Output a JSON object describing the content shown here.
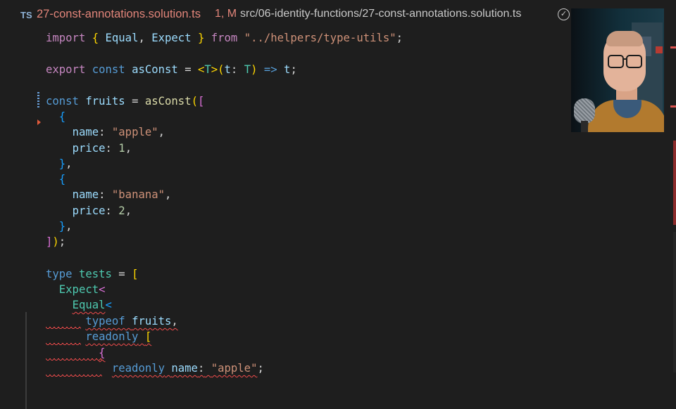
{
  "titlebar": {
    "lang_badge": "TS",
    "file_name": "27-const-annotations.solution.ts",
    "status": "1, M",
    "path": "src/06-identity-functions/27-const-annotations.solution.ts",
    "icons": [
      "check-circle-icon",
      "git-compare-icon",
      "more-icon"
    ]
  },
  "code": {
    "l1": [
      "import",
      "{",
      "Equal",
      ",",
      "Expect",
      "}",
      "from",
      "\"../helpers/type-utils\"",
      ";"
    ],
    "l2": [
      "export",
      "const",
      "asConst",
      "=",
      "<",
      "T",
      ">",
      "(",
      "t",
      ":",
      "T",
      ")",
      "=>",
      "t",
      ";"
    ],
    "l3": [
      "const",
      "fruits",
      "=",
      "asConst",
      "(",
      "["
    ],
    "l4": [
      "{"
    ],
    "l5": [
      "name",
      ":",
      "\"apple\"",
      ","
    ],
    "l6": [
      "price",
      ":",
      "1",
      ","
    ],
    "l7": [
      "}",
      ","
    ],
    "l8": [
      "{"
    ],
    "l9": [
      "name",
      ":",
      "\"banana\"",
      ","
    ],
    "l10": [
      "price",
      ":",
      "2",
      ","
    ],
    "l11": [
      "}",
      ","
    ],
    "l12": [
      "]",
      ")",
      ";"
    ],
    "l13": [
      "type",
      "tests",
      "=",
      "["
    ],
    "l14": [
      "Expect",
      "<"
    ],
    "l15": [
      "Equal",
      "<"
    ],
    "l16": [
      "typeof",
      "fruits",
      ","
    ],
    "l17": [
      "readonly",
      "["
    ],
    "l18": [
      "{"
    ],
    "l19": [
      "readonly",
      "name",
      ":",
      "\"apple\"",
      ";"
    ]
  },
  "colors": {
    "keyword": "#c586c0",
    "declaration": "#569cd6",
    "variable": "#9cdcfe",
    "function": "#dcdcaa",
    "type": "#4ec9b0",
    "string": "#ce9178",
    "number": "#b5cea8",
    "error": "#f14c4c",
    "modified_tab": "#e2857a"
  }
}
